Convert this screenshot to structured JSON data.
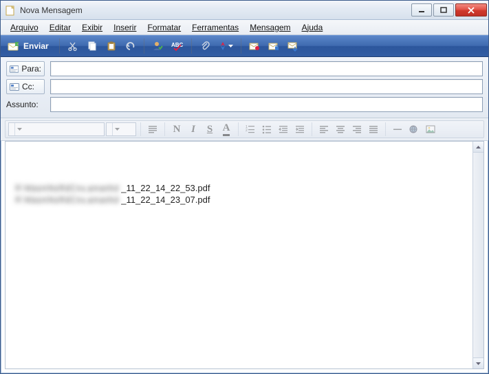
{
  "window": {
    "title": "Nova Mensagem"
  },
  "menu": {
    "arquivo": "Arquivo",
    "editar": "Editar",
    "exibir": "Exibir",
    "inserir": "Inserir",
    "formatar": "Formatar",
    "ferramentas": "Ferramentas",
    "mensagem": "Mensagem",
    "ajuda": "Ajuda"
  },
  "toolbar": {
    "send_label": "Enviar"
  },
  "headers": {
    "to_label": "Para:",
    "cc_label": "Cc:",
    "subject_label": "Assunto:",
    "to_value": "",
    "cc_value": "",
    "subject_value": ""
  },
  "format": {
    "font_value": "",
    "size_value": "",
    "bold": "N",
    "italic": "I",
    "underline": "S",
    "strike": "A"
  },
  "body": {
    "attachments": [
      {
        "obscured": "R WasmNoRdCnx.amanhd",
        "visible": "_11_22_14_22_53.pdf"
      },
      {
        "obscured": "R WasmNoRdCnx.amanhd",
        "visible": "_11_22_14_23_07.pdf"
      }
    ]
  }
}
